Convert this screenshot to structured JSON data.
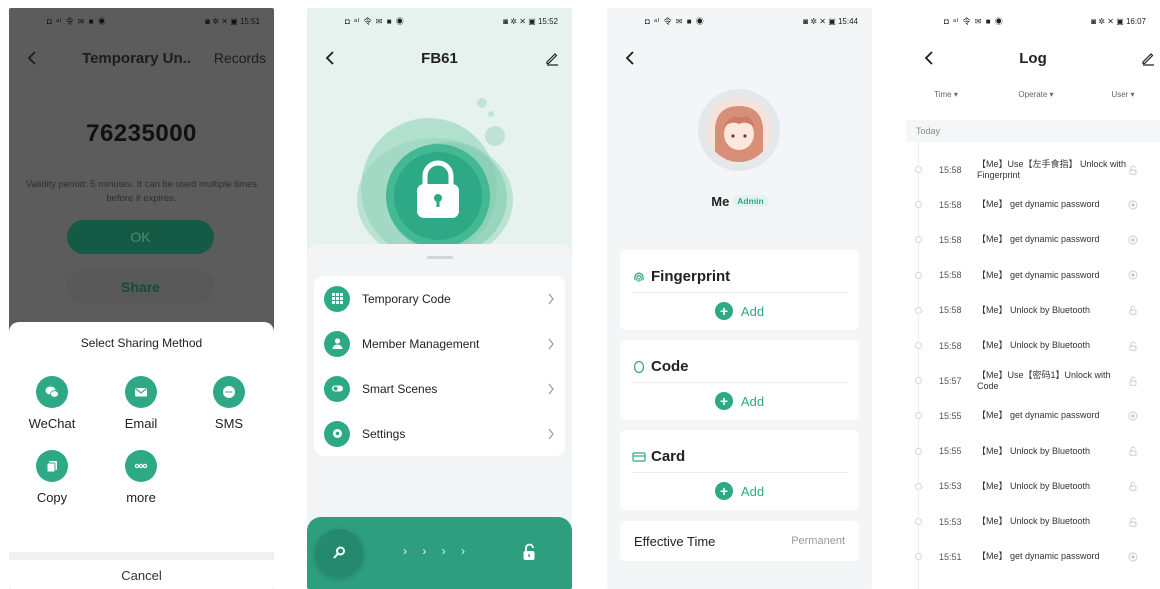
{
  "phone1": {
    "status_left": "◘ ᵃᴵ 令 ✉ ■ ◉",
    "status_right": "◙ ✲ ✕ ▣ 15:51",
    "title": "Temporary Un..",
    "records": "Records",
    "code": "76235000",
    "validity": "Validity period: 5 minutes. It can be used multiple times before it expires.",
    "ok": "OK",
    "share": "Share",
    "sheet_title": "Select Sharing Method",
    "share_options": [
      {
        "label": "WeChat",
        "icon": "wechat-icon"
      },
      {
        "label": "Email",
        "icon": "email-icon"
      },
      {
        "label": "SMS",
        "icon": "sms-icon"
      },
      {
        "label": "Copy",
        "icon": "copy-icon"
      },
      {
        "label": "more",
        "icon": "more-icon"
      }
    ],
    "cancel": "Cancel"
  },
  "phone2": {
    "status_left": "◘ ᵃᴵ 令 ✉ ■ ◉",
    "status_right": "◙ ✲ ✕ ▣ 15:52",
    "title": "FB61",
    "menu": [
      {
        "label": "Temporary Code",
        "icon": "grid-icon"
      },
      {
        "label": "Member Management",
        "icon": "person-icon"
      },
      {
        "label": "Smart Scenes",
        "icon": "toggle-icon"
      },
      {
        "label": "Settings",
        "icon": "gear-icon"
      }
    ],
    "arrows": "› › › ›"
  },
  "phone3": {
    "status_left": "◘ ᵃᴵ 令 ✉ ■ ◉",
    "status_right": "◙ ✲ ✕ ▣ 15:44",
    "name": "Me",
    "role": "Admin",
    "sections": [
      {
        "label": "Fingerprint",
        "icon": "fingerprint-icon",
        "add": "Add"
      },
      {
        "label": "Code",
        "icon": "code-icon",
        "add": "Add"
      },
      {
        "label": "Card",
        "icon": "card-icon",
        "add": "Add"
      }
    ],
    "effective_label": "Effective Time",
    "effective_value": "Permanent"
  },
  "phone4": {
    "status_left": "◘ ᵃᴵ 令 ✉ ■ ◉",
    "status_right": "◙ ✲ ✕ ▣ 16:07",
    "title": "Log",
    "filters": [
      "Time ▾",
      "Operate ▾",
      "User ▾"
    ],
    "section": "Today",
    "entries": [
      {
        "time": "15:58",
        "text": "【Me】Use【左手食指】 Unlock with Fingerprint",
        "icon": "unlock-icon"
      },
      {
        "time": "15:58",
        "text": "【Me】 get dynamic password",
        "icon": "password-icon"
      },
      {
        "time": "15:58",
        "text": "【Me】 get dynamic password",
        "icon": "password-icon"
      },
      {
        "time": "15:58",
        "text": "【Me】 get dynamic password",
        "icon": "password-icon"
      },
      {
        "time": "15:58",
        "text": "【Me】 Unlock by Bluetooth",
        "icon": "unlock-icon"
      },
      {
        "time": "15:58",
        "text": "【Me】 Unlock by Bluetooth",
        "icon": "unlock-icon"
      },
      {
        "time": "15:57",
        "text": "【Me】Use【密码1】Unlock with Code",
        "icon": "unlock-icon"
      },
      {
        "time": "15:55",
        "text": "【Me】 get dynamic password",
        "icon": "password-icon"
      },
      {
        "time": "15:55",
        "text": "【Me】 Unlock by Bluetooth",
        "icon": "unlock-icon"
      },
      {
        "time": "15:53",
        "text": "【Me】 Unlock by Bluetooth",
        "icon": "unlock-icon"
      },
      {
        "time": "15:53",
        "text": "【Me】 Unlock by Bluetooth",
        "icon": "unlock-icon"
      },
      {
        "time": "15:51",
        "text": "【Me】 get dynamic password",
        "icon": "password-icon"
      }
    ]
  },
  "colors": {
    "accent": "#2ea985",
    "accent_dark": "#258a6d",
    "overlay": "#5c5c5c"
  }
}
